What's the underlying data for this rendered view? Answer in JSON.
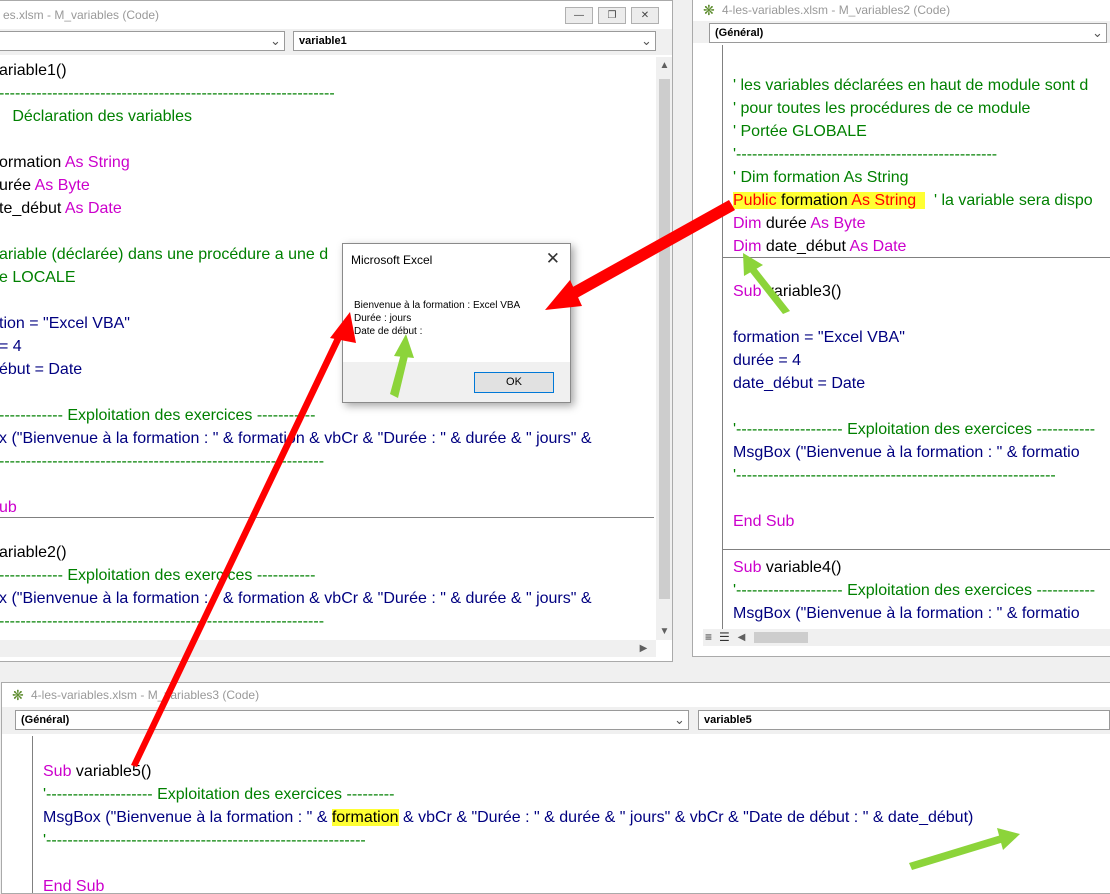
{
  "win1": {
    "title": "es.xlsm - M_variables (Code)",
    "left_combo": "",
    "right_combo": "variable1",
    "lines": [
      [
        {
          "t": "ariable1()",
          "c": ""
        }
      ],
      [
        {
          "t": "---------------------------------------------------------------",
          "c": "cm"
        }
      ],
      [
        {
          "t": "   Déclaration des variables",
          "c": "cm"
        }
      ],
      [
        {
          "t": "",
          "c": ""
        }
      ],
      [
        {
          "t": "ormation ",
          "c": ""
        },
        {
          "t": "As String",
          "c": "kw"
        }
      ],
      [
        {
          "t": "urée ",
          "c": ""
        },
        {
          "t": "As Byte",
          "c": "kw"
        }
      ],
      [
        {
          "t": "te_début ",
          "c": ""
        },
        {
          "t": "As Date",
          "c": "kw"
        }
      ],
      [
        {
          "t": "",
          "c": ""
        }
      ],
      [
        {
          "t": "ariable (déclarée) dans une procédure a une d                               mitée à la m",
          "c": "cm"
        }
      ],
      [
        {
          "t": "e LOCALE",
          "c": "cm"
        }
      ],
      [
        {
          "t": "",
          "c": ""
        }
      ],
      [
        {
          "t": "tion = \"Excel VBA\"",
          "c": "str"
        }
      ],
      [
        {
          "t": "= 4",
          "c": "str"
        }
      ],
      [
        {
          "t": "ébut = Date",
          "c": "str"
        }
      ],
      [
        {
          "t": "",
          "c": ""
        }
      ],
      [
        {
          "t": "------------ Exploitation des exercices -----------",
          "c": "cm"
        }
      ],
      [
        {
          "t": "x (\"Bienvenue à la formation : \" & formation & vbCr & \"Durée : \" & durée & \" jours\" &",
          "c": "str"
        }
      ],
      [
        {
          "t": "-------------------------------------------------------------",
          "c": "cm"
        }
      ],
      [
        {
          "t": "",
          "c": ""
        }
      ],
      [
        {
          "t": "ub",
          "c": "kw"
        }
      ]
    ],
    "lines2": [
      [
        {
          "t": "ariable2()",
          "c": ""
        }
      ],
      [
        {
          "t": "------------ Exploitation des exercices -----------",
          "c": "cm"
        }
      ],
      [
        {
          "t": "x (\"Bienvenue à la formation : \" & formation & vbCr & \"Durée : \" & durée & \" jours\" &",
          "c": "str"
        }
      ],
      [
        {
          "t": "-------------------------------------------------------------",
          "c": "cm"
        }
      ]
    ]
  },
  "win2": {
    "title": "4-les-variables.xlsm - M_variables2 (Code)",
    "left_combo": "(Général)",
    "lines": [
      [
        {
          "t": "",
          "c": ""
        }
      ],
      [
        {
          "t": "' les variables déclarées en haut de module sont d",
          "c": "cm"
        }
      ],
      [
        {
          "t": "' pour toutes les procédures de ce module",
          "c": "cm"
        }
      ],
      [
        {
          "t": "' Portée GLOBALE",
          "c": "cm"
        }
      ],
      [
        {
          "t": "'-------------------------------------------------",
          "c": "cm"
        }
      ],
      [
        {
          "t": "' Dim formation As String",
          "c": "cm"
        }
      ],
      [
        {
          "t": "Public",
          "c": "hlr"
        },
        {
          "t": " formation ",
          "c": "hl"
        },
        {
          "t": "As String",
          "c": "hlr"
        },
        {
          "t": "  ",
          "c": "hl"
        },
        {
          "t": "  ' la variable sera dispo",
          "c": "cm"
        }
      ],
      [
        {
          "t": "Dim",
          "c": "kw"
        },
        {
          "t": " durée ",
          "c": ""
        },
        {
          "t": "As Byte",
          "c": "kw"
        }
      ],
      [
        {
          "t": "Dim",
          "c": "kw"
        },
        {
          "t": " date_début ",
          "c": ""
        },
        {
          "t": "As Date",
          "c": "kw"
        }
      ]
    ],
    "lines2": [
      [
        {
          "t": "Sub",
          "c": "kw"
        },
        {
          "t": " variable3()",
          "c": ""
        }
      ],
      [
        {
          "t": "",
          "c": ""
        }
      ],
      [
        {
          "t": "formation = \"Excel VBA\"",
          "c": "str"
        }
      ],
      [
        {
          "t": "durée = 4",
          "c": "str"
        }
      ],
      [
        {
          "t": "date_début = Date",
          "c": "str"
        }
      ],
      [
        {
          "t": "",
          "c": ""
        }
      ],
      [
        {
          "t": "'-------------------- Exploitation des exercices -----------",
          "c": "cm"
        }
      ],
      [
        {
          "t": "MsgBox (\"Bienvenue à la formation : \" & formatio",
          "c": "str"
        }
      ],
      [
        {
          "t": "'------------------------------------------------------------",
          "c": "cm"
        }
      ],
      [
        {
          "t": "",
          "c": ""
        }
      ],
      [
        {
          "t": "End Sub",
          "c": "kw"
        }
      ]
    ],
    "lines3": [
      [
        {
          "t": "Sub",
          "c": "kw"
        },
        {
          "t": " variable4()",
          "c": ""
        }
      ],
      [
        {
          "t": "'-------------------- Exploitation des exercices -----------",
          "c": "cm"
        }
      ],
      [
        {
          "t": "MsgBox (\"Bienvenue à la formation : \" & formatio",
          "c": "str"
        }
      ]
    ]
  },
  "win3": {
    "title": "4-les-variables.xlsm - M_variables3 (Code)",
    "left_combo": "(Général)",
    "right_combo": "variable5",
    "lines": [
      [
        {
          "t": "Sub",
          "c": "kw"
        },
        {
          "t": " variable5()",
          "c": ""
        }
      ],
      [
        {
          "t": "'-------------------- Exploitation des exercices ---------",
          "c": "cm"
        }
      ],
      [
        {
          "t": "MsgBox (\"Bienvenue à la formation : \" & ",
          "c": "str"
        },
        {
          "t": "formation",
          "c": "hl"
        },
        {
          "t": " & vbCr & \"Durée : \" & durée & \" jours\" & vbCr & \"Date de début : \" & date_début)",
          "c": "str"
        }
      ],
      [
        {
          "t": "'------------------------------------------------------------",
          "c": "cm"
        }
      ],
      [
        {
          "t": "End Sub",
          "c": "kw"
        }
      ]
    ]
  },
  "dialog": {
    "title": "Microsoft Excel",
    "close": "✕",
    "msg1": "Bienvenue à la formation : Excel VBA",
    "msg2": "Durée :  jours",
    "msg3": "Date de début :",
    "ok": "OK"
  },
  "colors": {
    "keyword": "#cc00cc",
    "comment": "#008000",
    "string_line": "#000080",
    "highlight": "#ffff33",
    "arrow_red": "#ff0000",
    "arrow_green": "#8cd43a"
  }
}
